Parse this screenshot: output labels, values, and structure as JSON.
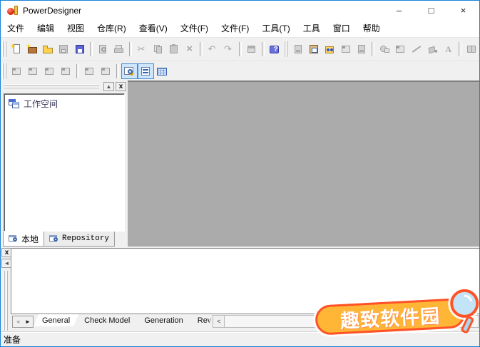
{
  "window": {
    "title": "PowerDesigner",
    "border_color": "#1883d7"
  },
  "titlebar": {
    "minimize_glyph": "–",
    "maximize_glyph": "□",
    "close_glyph": "×"
  },
  "menubar": {
    "items": [
      {
        "name": "menu-file",
        "label": "文件"
      },
      {
        "name": "menu-edit",
        "label": "编辑"
      },
      {
        "name": "menu-view",
        "label": "视图"
      },
      {
        "name": "menu-repository",
        "label": "仓库(R)"
      },
      {
        "name": "menu-browse",
        "label": "查看(V)"
      },
      {
        "name": "menu-file-f1",
        "label": "文件(F)"
      },
      {
        "name": "menu-file-f2",
        "label": "文件(F)"
      },
      {
        "name": "menu-tools-t",
        "label": "工具(T)"
      },
      {
        "name": "menu-tools",
        "label": "工具"
      },
      {
        "name": "menu-window",
        "label": "窗口"
      },
      {
        "name": "menu-help",
        "label": "帮助"
      }
    ]
  },
  "toolbar_main": {
    "items": [
      {
        "t": "grip"
      },
      {
        "t": "btn",
        "icon": "new-model-icon",
        "cls": "ic-new-model spark",
        "name": "new-model-button",
        "state": "normal"
      },
      {
        "t": "btn",
        "icon": "new-workspace-icon",
        "cls": "ic-new-workspace spark",
        "name": "new-workspace-button",
        "state": "normal"
      },
      {
        "t": "btn",
        "icon": "open-icon",
        "cls": "ic-open",
        "name": "open-button",
        "state": "normal"
      },
      {
        "t": "btn",
        "icon": "save-icon",
        "cls": "ic-save-disabled",
        "name": "save-button",
        "state": "disabled"
      },
      {
        "t": "btn",
        "icon": "save-all-icon",
        "cls": "ic-save-all",
        "name": "save-all-button",
        "state": "normal"
      },
      {
        "t": "sep"
      },
      {
        "t": "btn",
        "icon": "print-preview-icon",
        "cls": "ic-print-preview",
        "name": "print-preview-button",
        "state": "disabled"
      },
      {
        "t": "btn",
        "icon": "print-icon",
        "cls": "ic-print",
        "name": "print-button",
        "state": "disabled"
      },
      {
        "t": "sep"
      },
      {
        "t": "btn",
        "icon": "cut-icon",
        "cls": "ic-cut",
        "name": "cut-button",
        "state": "disabled"
      },
      {
        "t": "btn",
        "icon": "copy-icon",
        "cls": "ic-copy",
        "name": "copy-button",
        "state": "disabled"
      },
      {
        "t": "btn",
        "icon": "paste-icon",
        "cls": "ic-paste",
        "name": "paste-button",
        "state": "disabled"
      },
      {
        "t": "btn",
        "icon": "delete-icon",
        "cls": "ic-delete",
        "name": "delete-button",
        "state": "disabled"
      },
      {
        "t": "sep"
      },
      {
        "t": "btn",
        "icon": "undo-icon",
        "cls": "ic-undo",
        "name": "undo-button",
        "state": "disabled"
      },
      {
        "t": "btn",
        "icon": "redo-icon",
        "cls": "ic-redo",
        "name": "redo-button",
        "state": "disabled"
      },
      {
        "t": "sep"
      },
      {
        "t": "btn",
        "icon": "properties-icon",
        "cls": "ic-properties",
        "name": "properties-button",
        "state": "disabled"
      },
      {
        "t": "sep"
      },
      {
        "t": "btn",
        "icon": "help-icon",
        "cls": "ic-help",
        "name": "help-button",
        "state": "normal"
      },
      {
        "t": "grip"
      },
      {
        "t": "btn",
        "icon": "add-shortcut-icon",
        "cls": "ic-gray-doc",
        "name": "add-shortcut-button",
        "state": "disabled"
      },
      {
        "t": "btn",
        "icon": "paste-as-shortcut-icon",
        "cls": "ic-paste-shortcut",
        "name": "paste-as-shortcut-button",
        "state": "normal"
      },
      {
        "t": "btn",
        "icon": "find-objects-icon",
        "cls": "ic-find-objects",
        "name": "find-objects-button",
        "state": "normal"
      },
      {
        "t": "btn",
        "icon": "edit-icon",
        "cls": "ic-gray-win",
        "name": "edit-button",
        "state": "disabled"
      },
      {
        "t": "btn",
        "icon": "generate-icon",
        "cls": "ic-gray-doc",
        "name": "generate-button",
        "state": "disabled"
      },
      {
        "t": "sep"
      },
      {
        "t": "btn",
        "icon": "shape-icon",
        "cls": "ic-gray-shape",
        "name": "shape-button",
        "state": "disabled"
      },
      {
        "t": "btn",
        "icon": "frame-icon",
        "cls": "ic-gray-win",
        "name": "frame-button",
        "state": "disabled"
      },
      {
        "t": "btn",
        "icon": "line-icon",
        "cls": "ic-line",
        "name": "line-button",
        "state": "disabled"
      },
      {
        "t": "btn",
        "icon": "fill-color-icon",
        "cls": "ic-fill",
        "name": "fill-color-button",
        "state": "disabled"
      },
      {
        "t": "btn",
        "icon": "text-icon",
        "cls": "ic-text",
        "name": "text-button",
        "state": "disabled"
      },
      {
        "t": "sep"
      },
      {
        "t": "btn",
        "icon": "dictionary-icon",
        "cls": "ic-book-disabled",
        "name": "dictionary-button",
        "state": "disabled"
      }
    ]
  },
  "toolbar_view": {
    "items": [
      {
        "t": "grip"
      },
      {
        "t": "btn",
        "icon": "model-window-icon",
        "cls": "ic-gray-win",
        "name": "model-window-button-1",
        "state": "disabled"
      },
      {
        "t": "btn",
        "icon": "model-window-icon",
        "cls": "ic-gray-win",
        "name": "model-window-button-2",
        "state": "disabled"
      },
      {
        "t": "btn",
        "icon": "model-window-icon",
        "cls": "ic-gray-win",
        "name": "model-window-button-3",
        "state": "disabled"
      },
      {
        "t": "btn",
        "icon": "model-window-icon",
        "cls": "ic-gray-win",
        "name": "model-window-button-4",
        "state": "disabled"
      },
      {
        "t": "sep"
      },
      {
        "t": "btn",
        "icon": "diagram-window-icon",
        "cls": "ic-gray-win",
        "name": "diagram-window-button-1",
        "state": "disabled"
      },
      {
        "t": "btn",
        "icon": "diagram-window-icon",
        "cls": "ic-gray-win",
        "name": "diagram-window-button-2",
        "state": "disabled"
      },
      {
        "t": "sep"
      },
      {
        "t": "btn",
        "icon": "browser-icon",
        "cls": "ic-browser",
        "name": "browser-toggle-button",
        "state": "pressed"
      },
      {
        "t": "btn",
        "icon": "output-icon",
        "cls": "ic-output",
        "name": "output-toggle-button",
        "state": "pressed"
      },
      {
        "t": "btn",
        "icon": "result-list-icon",
        "cls": "ic-grid",
        "name": "result-list-button",
        "state": "normal"
      }
    ]
  },
  "left_panel": {
    "expand_glyph": "▲",
    "close_glyph": "x",
    "tree_items": [
      {
        "name": "tree-item-workspace",
        "label": "工作空间"
      }
    ],
    "tabs": [
      {
        "name": "panel-tab-local",
        "label": "本地",
        "active": true,
        "mono": false
      },
      {
        "name": "panel-tab-repository",
        "label": "Repository",
        "active": false,
        "mono": true
      }
    ]
  },
  "output_panel": {
    "close_glyph": "x",
    "collapse_glyph": "◄",
    "scroll_left_glyph": "◄",
    "scroll_right_glyph": "►",
    "hscroll_left_glyph": "<",
    "tabs": [
      {
        "name": "output-tab-general",
        "label": "General",
        "active": true,
        "clipped": false
      },
      {
        "name": "output-tab-check-model",
        "label": "Check Model",
        "active": false,
        "clipped": false
      },
      {
        "name": "output-tab-generation",
        "label": "Generation",
        "active": false,
        "clipped": false
      },
      {
        "name": "output-tab-reverse",
        "label": "Rev",
        "active": false,
        "clipped": true
      }
    ]
  },
  "statusbar": {
    "text": "准备"
  },
  "watermark": {
    "text": "趣致软件园",
    "badge_fill": "#ffb637",
    "badge_stroke": "#ff5226",
    "lens_fill": "#c2e4f6"
  }
}
